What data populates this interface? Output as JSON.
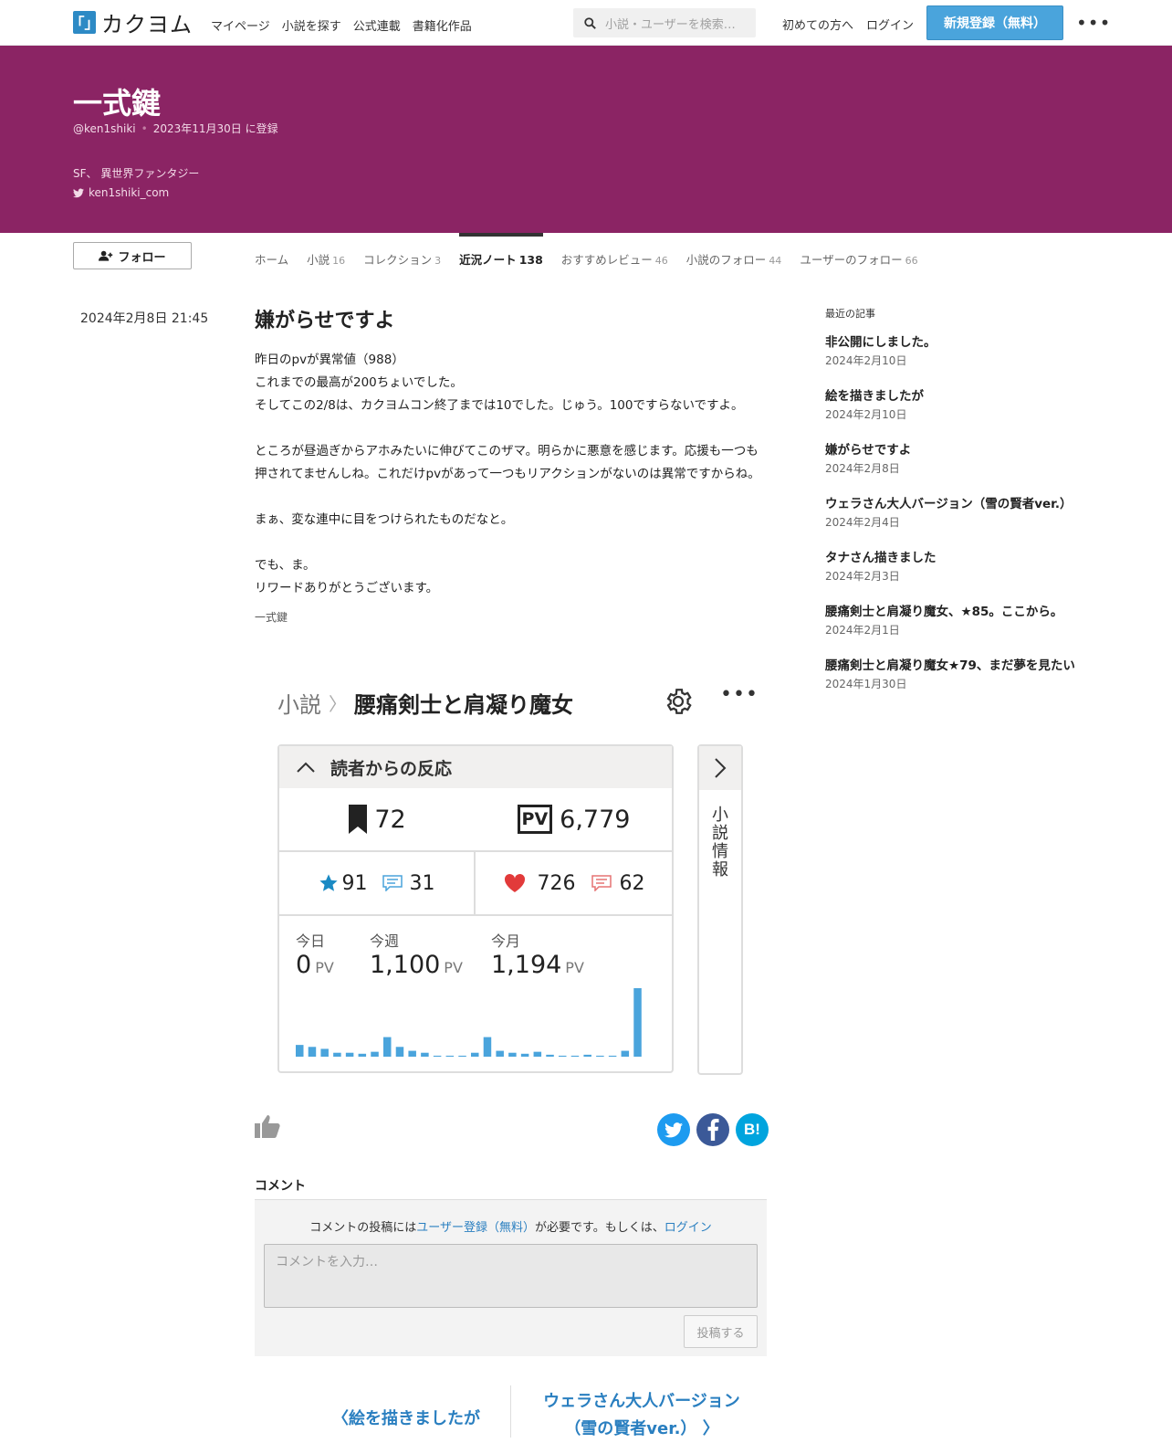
{
  "header": {
    "logo_mark": "「」",
    "logo_text": "カクヨム",
    "nav": [
      "マイページ",
      "小説を探す",
      "公式連載",
      "書籍化作品"
    ],
    "search_placeholder": "小説・ユーザーを検索…",
    "first_time": "初めての方へ",
    "login": "ログイン",
    "signup": "新規登録（無料）"
  },
  "author": {
    "name": "一式鍵",
    "handle": "@ken1shiki",
    "registered": "2023年11月30日 に登録",
    "genres": "SF、 異世界ファンタジー",
    "twitter": "ken1shiki_com",
    "follow_label": "フォロー"
  },
  "tabs": [
    {
      "label": "ホーム",
      "count": ""
    },
    {
      "label": "小説",
      "count": "16"
    },
    {
      "label": "コレクション",
      "count": "3"
    },
    {
      "label": "近況ノート",
      "count": "138"
    },
    {
      "label": "おすすめレビュー",
      "count": "46"
    },
    {
      "label": "小説のフォロー",
      "count": "44"
    },
    {
      "label": "ユーザーのフォロー",
      "count": "66"
    }
  ],
  "post": {
    "date": "2024年2月8日 21:45",
    "title": "嫌がらせですよ",
    "lines": [
      "昨日のpvが異常値（988）",
      "これまでの最高が200ちょいでした。",
      "そしてこの2/8は、カクヨムコン終了までは10でした。じゅう。100ですらないですよ。",
      "",
      "ところが昼過ぎからアホみたいに伸びてこのザマ。明らかに悪意を感じます。応援も一つも押されてませんしね。これだけpvがあって一つもリアクションがないのは異常ですからね。",
      "",
      "まぁ、変な連中に目をつけられたものだなと。",
      "",
      "でも、ま。",
      "リワードありがとうございます。"
    ],
    "signature": "一式鍵"
  },
  "embedded": {
    "crumb_root": "小説",
    "novel_title": "腰痛剣士と肩凝り魔女",
    "panel_title": "読者からの反応",
    "bookmarks": "72",
    "pv_badge": "PV",
    "pv_total": "6,779",
    "stars": "91",
    "star_reviews": "31",
    "hearts": "726",
    "heart_comments": "62",
    "today_label": "今日",
    "today_value": "0",
    "week_label": "今週",
    "week_value": "1,100",
    "month_label": "今月",
    "month_value": "1,194",
    "pv_unit": "PV",
    "side_label": "小説情報",
    "daily_pv": [
      12,
      10,
      8,
      4,
      4,
      3,
      5,
      20,
      10,
      6,
      4,
      1,
      1,
      1,
      4,
      20,
      6,
      4,
      3,
      5,
      2,
      1,
      1,
      2,
      1,
      1,
      6,
      70
    ],
    "bar_color": "#4aa4dc"
  },
  "comments": {
    "title": "コメント",
    "note_pre": "コメントの投稿には",
    "note_link1": "ユーザー登録（無料）",
    "note_mid": "が必要です。もしくは、",
    "note_link2": "ログイン",
    "placeholder": "コメントを入力…",
    "submit": "投稿する"
  },
  "pager": {
    "prev": "絵を描きましたが",
    "next_line1": "ウェラさん大人バージョン",
    "next_line2": "（雪の賢者ver.）"
  },
  "recent": {
    "heading": "最近の記事",
    "items": [
      {
        "title": "非公開にしました。",
        "date": "2024年2月10日"
      },
      {
        "title": "絵を描きましたが",
        "date": "2024年2月10日"
      },
      {
        "title": "嫌がらせですよ",
        "date": "2024年2月8日"
      },
      {
        "title": "ウェラさん大人バージョン（雪の賢者ver.）",
        "date": "2024年2月4日"
      },
      {
        "title": "タナさん描きました",
        "date": "2024年2月3日"
      },
      {
        "title": "腰痛剣士と肩凝り魔女、★85。ここから。",
        "date": "2024年2月1日"
      },
      {
        "title": "腰痛剣士と肩凝り魔女★79、まだ夢を見たい",
        "date": "2024年1月30日"
      }
    ]
  },
  "colors": {
    "banner": "#8b2464",
    "accent_blue": "#4aa4dc",
    "link_blue": "#2a7fc0",
    "twitter": "#1d9bf0",
    "facebook": "#3b5998",
    "hatena": "#00a4de"
  }
}
